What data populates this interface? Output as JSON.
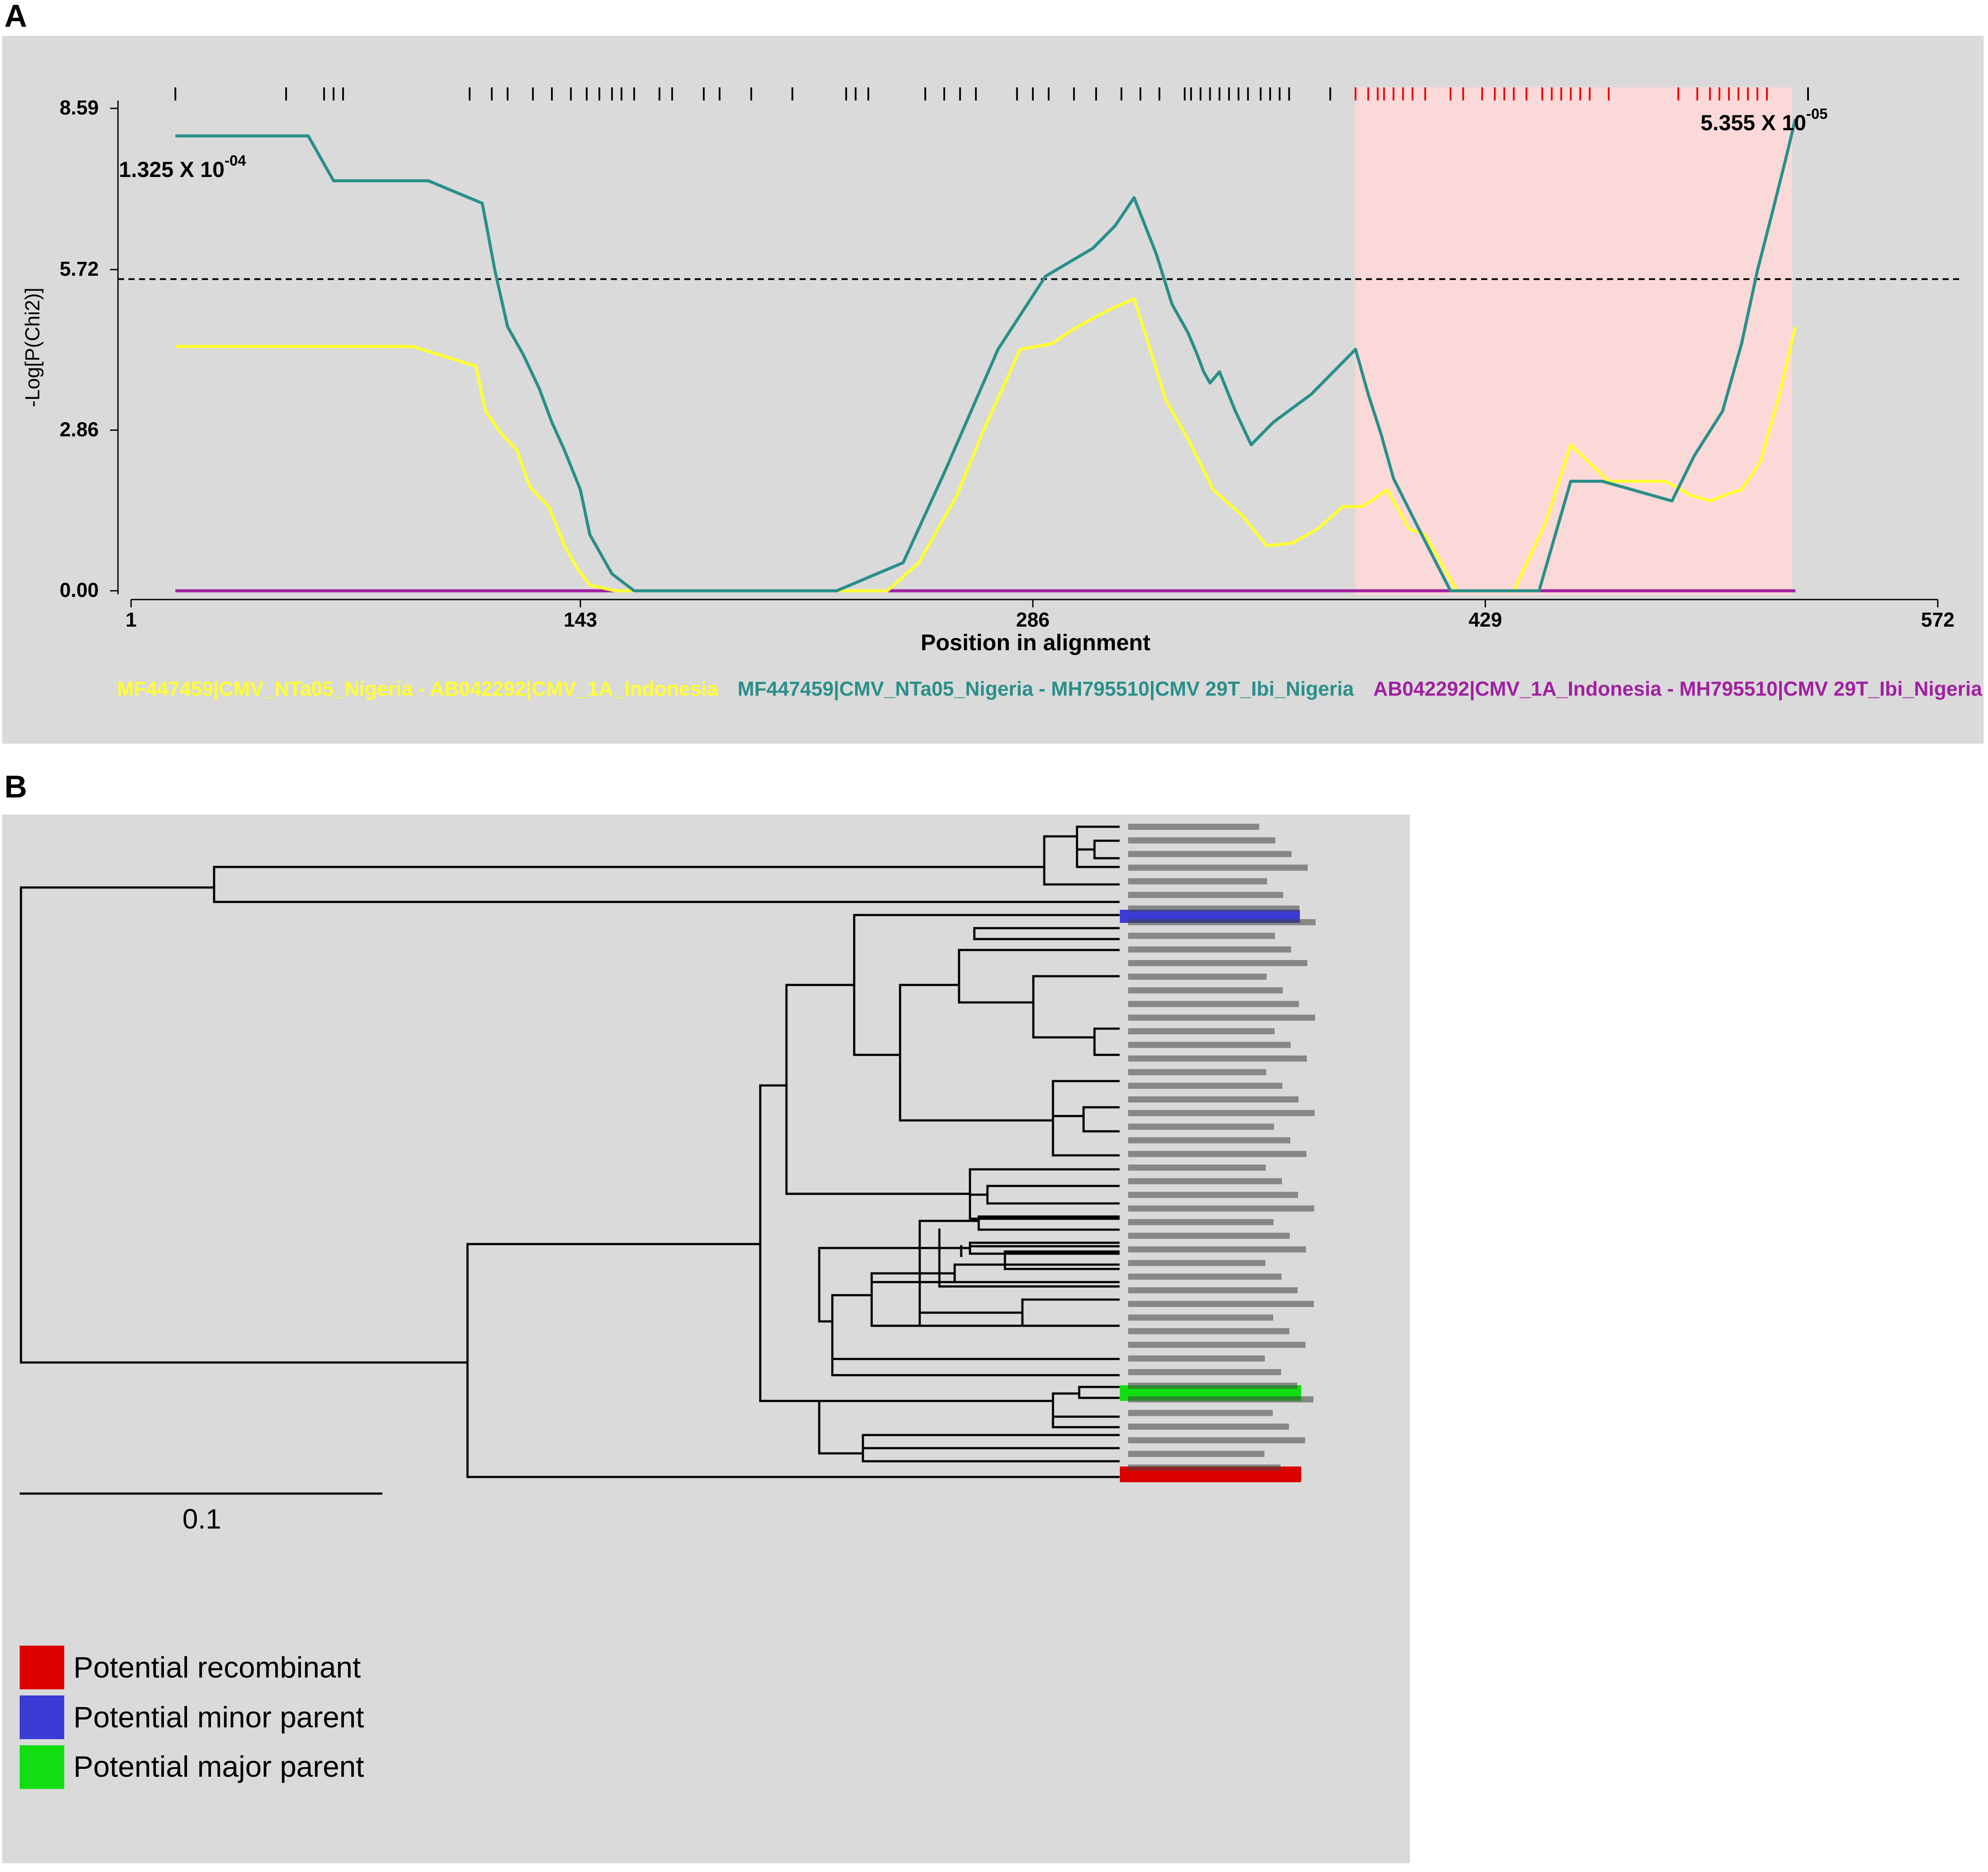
{
  "panels": {
    "a_label": "A",
    "b_label": "B"
  },
  "colors": {
    "panel_bg": "#dadada",
    "yellow_series": "#ffff33",
    "teal_series": "#2a8f8a",
    "purple_series": "#a020a0",
    "highlight_region": "#fcd9d9",
    "site_tick_black": "#000000",
    "site_tick_red": "#ee0000",
    "recombinant": "#dd0000",
    "minor_parent": "#3b3bd6",
    "major_parent": "#11dd11"
  },
  "chart_data": [
    {
      "type": "line",
      "xlabel": "Position in alignment",
      "ylabel": "-Log[P(Chi2)]",
      "xlim": [
        1,
        572
      ],
      "ylim": [
        0,
        8.59
      ],
      "x_ticks": [
        "1",
        "143",
        "286",
        "429",
        "572"
      ],
      "x_tick_values": [
        1,
        143,
        286,
        429,
        572
      ],
      "y_ticks": [
        "0.00",
        "2.86",
        "5.72",
        "8.59"
      ],
      "y_tick_values": [
        0,
        2.86,
        5.72,
        8.59
      ],
      "threshold": 5.55,
      "highlight_region": [
        388,
        526
      ],
      "annotations": {
        "left_prefix": "1.325 X 10",
        "left_exponent": "-04",
        "right_prefix": "5.355 X 10",
        "right_exponent": "-05"
      },
      "informative_sites_black": [
        15,
        50,
        62,
        65,
        68,
        108,
        115,
        120,
        128,
        134,
        140,
        145,
        149,
        153,
        156,
        160,
        168,
        172,
        182,
        187,
        197,
        210,
        227,
        230,
        234,
        252,
        258,
        263,
        268,
        281,
        286,
        291,
        299,
        306,
        314,
        320,
        326,
        334,
        336,
        339,
        342,
        345,
        348,
        351,
        354,
        358,
        361,
        364,
        367,
        380,
        531
      ],
      "informative_sites_red": [
        388,
        392,
        395,
        397,
        400,
        403,
        406,
        410,
        418,
        422,
        428,
        432,
        435,
        438,
        442,
        447,
        450,
        453,
        456,
        459,
        462,
        468,
        490,
        496,
        500,
        503,
        506,
        509,
        512,
        515,
        518
      ],
      "series": [
        {
          "name": "MF447459|CMV_NTa05_Nigeria - AB042292|CMV_1A_Indonesia",
          "x": [
            15,
            90,
            110,
            113,
            118,
            123,
            127,
            133,
            138,
            142,
            146,
            154,
            240,
            250,
            262,
            270,
            282,
            292,
            300,
            310,
            318,
            322,
            328,
            336,
            343,
            352,
            360,
            368,
            376,
            384,
            390,
            393,
            398,
            405,
            410,
            420,
            428,
            433,
            438,
            443,
            448,
            456,
            468,
            486,
            494,
            500,
            507,
            510,
            516,
            522,
            527
          ],
          "y": [
            4.35,
            4.35,
            4.0,
            3.2,
            2.8,
            2.5,
            1.85,
            1.5,
            0.8,
            0.4,
            0.1,
            0.0,
            0.0,
            0.5,
            1.7,
            2.8,
            4.3,
            4.4,
            4.7,
            5.0,
            5.2,
            4.5,
            3.4,
            2.6,
            1.8,
            1.35,
            0.8,
            0.85,
            1.1,
            1.5,
            1.5,
            1.6,
            1.8,
            1.1,
            1.0,
            0.0,
            0.0,
            0.0,
            0.0,
            0.6,
            1.2,
            2.6,
            1.95,
            1.95,
            1.7,
            1.6,
            1.75,
            1.8,
            2.3,
            3.5,
            4.7
          ]
        },
        {
          "name": "MF447459|CMV_NTa05_Nigeria - MH795510|CMV 29T_Ibi_Nigeria",
          "x": [
            15,
            57,
            65,
            95,
            112,
            116,
            120,
            125,
            130,
            134,
            138,
            143,
            146,
            153,
            160,
            224,
            245,
            258,
            275,
            290,
            305,
            312,
            318,
            325,
            330,
            335,
            338,
            340,
            342,
            345,
            350,
            355,
            362,
            374,
            388,
            392,
            396,
            400,
            408,
            418,
            426,
            428,
            434,
            442,
            446,
            456,
            466,
            488,
            495,
            504,
            510,
            515,
            520,
            524,
            527
          ],
          "y": [
            8.1,
            8.1,
            7.3,
            7.3,
            6.9,
            5.7,
            4.7,
            4.2,
            3.6,
            3.0,
            2.5,
            1.8,
            1.0,
            0.3,
            0.0,
            0.0,
            0.5,
            2.1,
            4.3,
            5.6,
            6.1,
            6.5,
            7.0,
            6.0,
            5.1,
            4.6,
            4.2,
            3.9,
            3.7,
            3.9,
            3.2,
            2.6,
            3.0,
            3.5,
            4.3,
            3.5,
            2.8,
            2.0,
            1.1,
            0.0,
            0.0,
            0.0,
            0.0,
            0.0,
            0.0,
            1.95,
            1.95,
            1.6,
            2.4,
            3.2,
            4.4,
            5.7,
            6.8,
            7.7,
            8.4
          ]
        },
        {
          "name": "AB042292|CMV_1A_Indonesia - MH795510|CMV 29T_Ibi_Nigeria",
          "x": [
            15,
            527
          ],
          "y": [
            0,
            0
          ]
        }
      ]
    },
    {
      "type": "tree",
      "scale_label": "0.1",
      "legend": [
        {
          "label": "Potential recombinant",
          "color": "#dd0000"
        },
        {
          "label": "Potential minor parent",
          "color": "#3b3bd6"
        },
        {
          "label": "Potential major parent",
          "color": "#11dd11"
        }
      ]
    }
  ]
}
